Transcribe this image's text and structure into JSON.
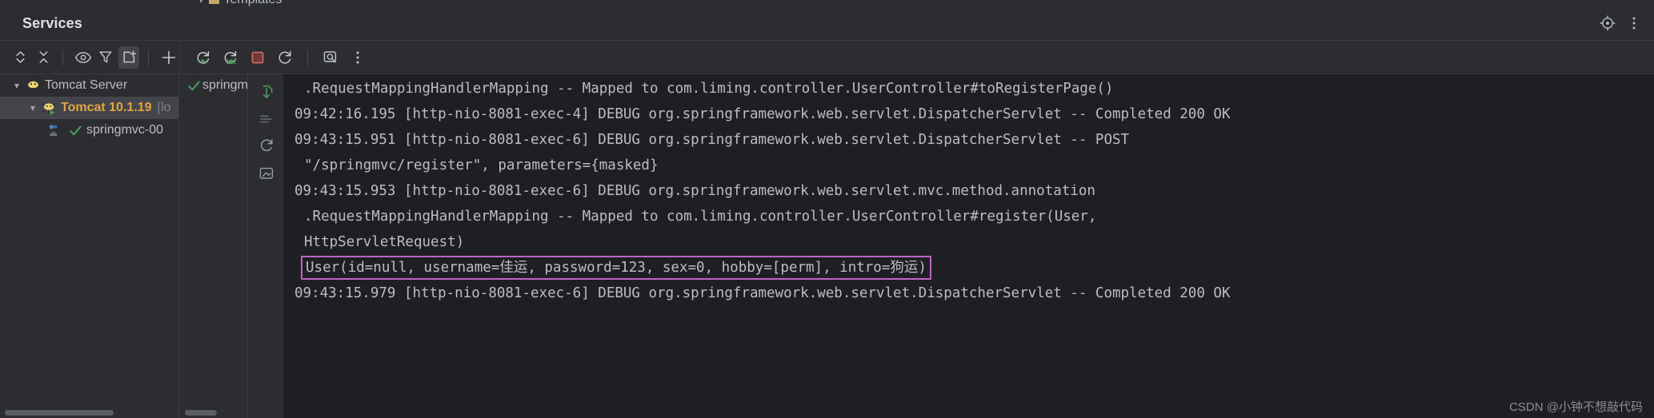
{
  "top_sliver": {
    "fragment_label": "Templates"
  },
  "header": {
    "title": "Services",
    "locate_icon": "target-icon",
    "options_icon": "more-vertical-icon"
  },
  "toolbar": {
    "left_group": [
      {
        "name": "expand-all-button",
        "icon": "chevrons-expand-icon",
        "tooltip": "Expand All"
      },
      {
        "name": "collapse-all-button",
        "icon": "chevrons-collapse-icon",
        "tooltip": "Collapse All"
      }
    ],
    "middle_group": [
      {
        "name": "show-services-button",
        "icon": "eye-icon",
        "tooltip": "Show"
      },
      {
        "name": "filter-button",
        "icon": "filter-icon",
        "tooltip": "Filter"
      },
      {
        "name": "open-in-new-tab-button",
        "icon": "add-tab-icon",
        "tooltip": "Open in New Tab",
        "active": true
      }
    ],
    "add_group": [
      {
        "name": "add-service-button",
        "icon": "plus-icon",
        "tooltip": "Add Service"
      }
    ],
    "run_group": [
      {
        "name": "rerun-button",
        "icon": "rerun-icon",
        "tooltip": "Rerun"
      },
      {
        "name": "rerun-debug-button",
        "icon": "rerun-debug-icon",
        "tooltip": "Rerun with Debug"
      },
      {
        "name": "stop-button",
        "icon": "stop-square-icon",
        "tooltip": "Stop"
      },
      {
        "name": "restart-button",
        "icon": "restart-icon",
        "tooltip": "Restart"
      },
      {
        "name": "deploy-button",
        "icon": "deploy-analyze-icon",
        "tooltip": "Deploy"
      },
      {
        "name": "more-actions-button",
        "icon": "more-vertical-icon",
        "tooltip": "More Actions"
      }
    ]
  },
  "tree": {
    "nodes": [
      {
        "label": "Tomcat Server",
        "suffix": "",
        "icon": "tomcat-icon",
        "level": 1,
        "expanded": true,
        "selected": false,
        "accent": false
      },
      {
        "label": "Tomcat 10.1.19",
        "suffix": "[lo",
        "icon": "tomcat-running-icon",
        "level": 2,
        "expanded": true,
        "selected": true,
        "accent": true
      },
      {
        "label": "springmvc-00",
        "suffix": "",
        "icon": "artifact-ok-icon",
        "level": 3,
        "expanded": false,
        "selected": false,
        "accent": false
      }
    ]
  },
  "tab_column": {
    "items": [
      {
        "label": "springmv",
        "icon": "check-green-icon"
      }
    ]
  },
  "console_gutter": {
    "icons": [
      {
        "name": "scroll-to-stacktrace-icon"
      },
      {
        "name": "scroll-to-end-icon"
      },
      {
        "name": "soft-wrap-icon"
      },
      {
        "name": "print-console-icon"
      }
    ]
  },
  "console": {
    "lines": [
      {
        "text": ".RequestMappingHandlerMapping -- Mapped to com.liming.controller.UserController#toRegisterPage()",
        "indent": true,
        "highlight": false
      },
      {
        "text": "09:42:16.195 [http-nio-8081-exec-4] DEBUG org.springframework.web.servlet.DispatcherServlet -- Completed 200 OK",
        "indent": false,
        "highlight": false
      },
      {
        "text": "09:43:15.951 [http-nio-8081-exec-6] DEBUG org.springframework.web.servlet.DispatcherServlet -- POST",
        "indent": false,
        "highlight": false
      },
      {
        "text": "\"/springmvc/register\", parameters={masked}",
        "indent": true,
        "highlight": false
      },
      {
        "text": "09:43:15.953 [http-nio-8081-exec-6] DEBUG org.springframework.web.servlet.mvc.method.annotation",
        "indent": false,
        "highlight": false
      },
      {
        "text": ".RequestMappingHandlerMapping -- Mapped to com.liming.controller.UserController#register(User,",
        "indent": true,
        "highlight": false
      },
      {
        "text": "HttpServletRequest)",
        "indent": true,
        "highlight": false
      },
      {
        "text": "User(id=null, username=佳运, password=123, sex=0, hobby=[perm], intro=狗运)",
        "indent": true,
        "highlight": true
      },
      {
        "text": "09:43:15.979 [http-nio-8081-exec-6] DEBUG org.springframework.web.servlet.DispatcherServlet -- Completed 200 OK",
        "indent": false,
        "highlight": false
      }
    ],
    "highlight_color": "#c061cb"
  },
  "watermark": {
    "text": "CSDN @小钟不想敲代码"
  }
}
